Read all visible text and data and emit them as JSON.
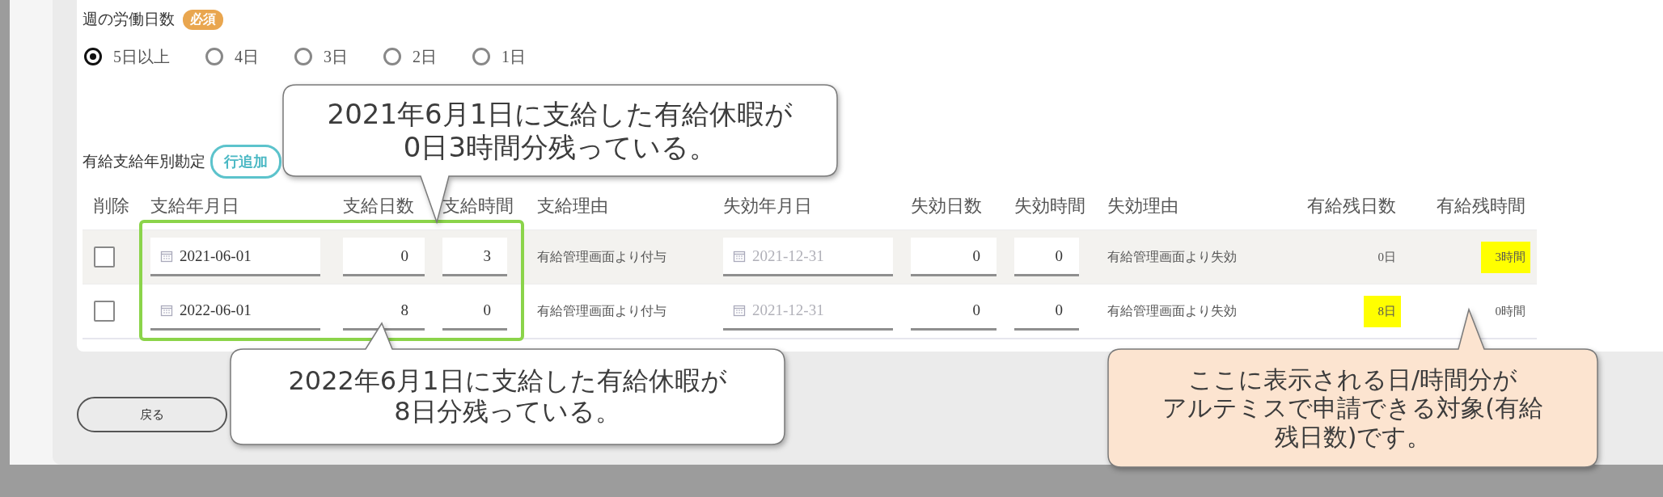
{
  "work_days": {
    "label": "週の労働日数",
    "badge": "必須",
    "options": [
      {
        "label": "5日以上",
        "selected": true
      },
      {
        "label": "4日",
        "selected": false
      },
      {
        "label": "3日",
        "selected": false
      },
      {
        "label": "2日",
        "selected": false
      },
      {
        "label": "1日",
        "selected": false
      }
    ]
  },
  "grant_section": {
    "label": "有給支給年別勘定",
    "add_button": "行追加",
    "columns": [
      "削除",
      "支給年月日",
      "支給日数",
      "支給時間",
      "支給理由",
      "失効年月日",
      "失効日数",
      "失効時間",
      "失効理由",
      "有給残日数",
      "有給残時間"
    ],
    "rows": [
      {
        "checked": false,
        "grant_date": "2021-06-01",
        "grant_days": "0",
        "grant_hours": "3",
        "grant_reason": "有給管理画面より付与",
        "expiry_date": "2021-12-31",
        "expiry_days": "0",
        "expiry_hours": "0",
        "expiry_reason": "有給管理画面より失効",
        "remaining_days": {
          "text": "0日",
          "highlighted": false
        },
        "remaining_hours": {
          "text": "3時間",
          "highlighted": true
        }
      },
      {
        "checked": false,
        "grant_date": "2022-06-01",
        "grant_days": "8",
        "grant_hours": "0",
        "grant_reason": "有給管理画面より付与",
        "expiry_date": "2021-12-31",
        "expiry_days": "0",
        "expiry_hours": "0",
        "expiry_reason": "有給管理画面より失効",
        "remaining_days": {
          "text": "8日",
          "highlighted": true
        },
        "remaining_hours": {
          "text": "0時間",
          "highlighted": false
        }
      }
    ]
  },
  "back_button": "戻る",
  "callouts": [
    {
      "kind": "note",
      "lines": [
        "2021年6月1日に支給した有給休暇が",
        "0日3時間分残っている。"
      ]
    },
    {
      "kind": "note",
      "lines": [
        "2022年6月1日に支給した有給休暇が",
        "8日分残っている。"
      ]
    },
    {
      "kind": "info",
      "lines": [
        "ここに表示される日/時間分が",
        "アルテミスで申請できる対象(有給",
        "残日数)です。"
      ]
    }
  ]
}
